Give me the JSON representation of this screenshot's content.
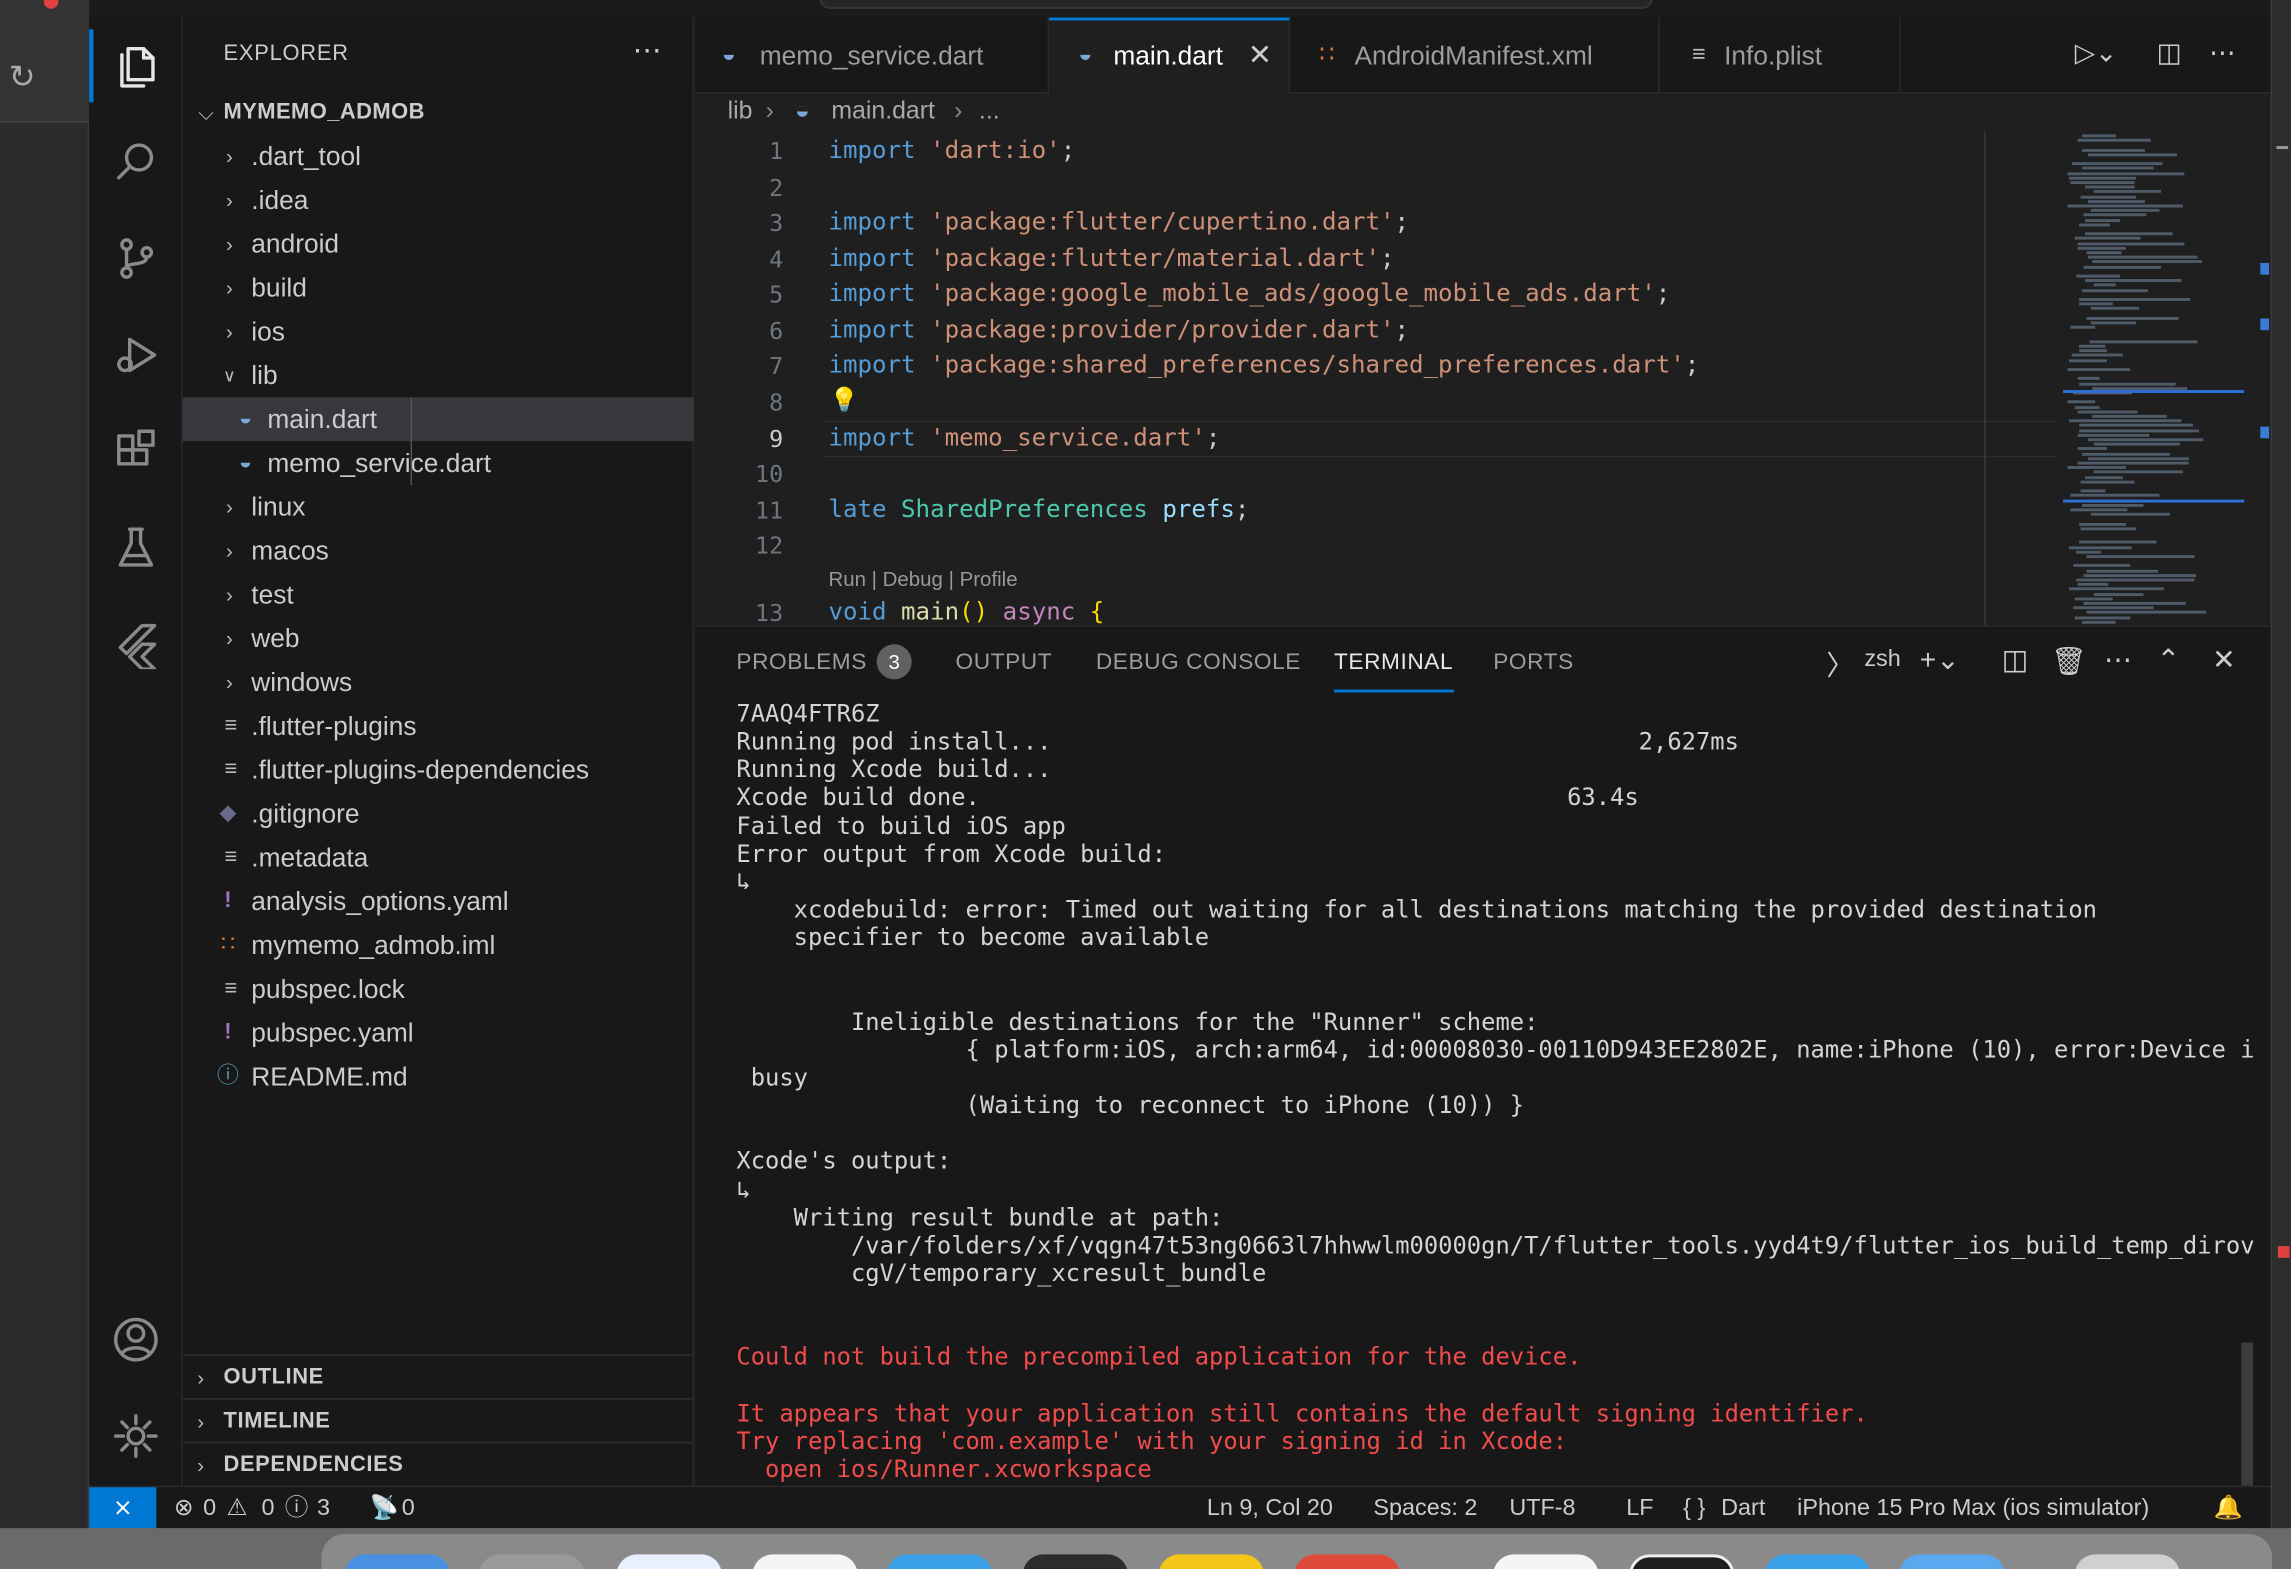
{
  "sidebar": {
    "title": "EXPLORER",
    "project": "MYMEMO_ADMOB",
    "items": [
      {
        "label": ".dart_tool",
        "type": "folder"
      },
      {
        "label": ".idea",
        "type": "folder"
      },
      {
        "label": "android",
        "type": "folder"
      },
      {
        "label": "build",
        "type": "folder"
      },
      {
        "label": "ios",
        "type": "folder"
      },
      {
        "label": "lib",
        "type": "folder-open"
      },
      {
        "label": "main.dart",
        "type": "dart"
      },
      {
        "label": "memo_service.dart",
        "type": "dart"
      },
      {
        "label": "linux",
        "type": "folder"
      },
      {
        "label": "macos",
        "type": "folder"
      },
      {
        "label": "test",
        "type": "folder"
      },
      {
        "label": "web",
        "type": "folder"
      },
      {
        "label": "windows",
        "type": "folder"
      },
      {
        "label": ".flutter-plugins",
        "type": "file"
      },
      {
        "label": ".flutter-plugins-dependencies",
        "type": "file"
      },
      {
        "label": ".gitignore",
        "type": "git"
      },
      {
        "label": ".metadata",
        "type": "file"
      },
      {
        "label": "analysis_options.yaml",
        "type": "yaml"
      },
      {
        "label": "mymemo_admob.iml",
        "type": "rss"
      },
      {
        "label": "pubspec.lock",
        "type": "file"
      },
      {
        "label": "pubspec.yaml",
        "type": "yaml"
      },
      {
        "label": "README.md",
        "type": "info"
      }
    ],
    "sections": [
      "OUTLINE",
      "TIMELINE",
      "DEPENDENCIES"
    ]
  },
  "tabs": [
    {
      "label": "memo_service.dart"
    },
    {
      "label": "main.dart"
    },
    {
      "label": "AndroidManifest.xml"
    },
    {
      "label": "Info.plist"
    }
  ],
  "breadcrumb": {
    "folder": "lib",
    "file": "main.dart",
    "more": "..."
  },
  "editor": {
    "line_numbers": [
      "1",
      "2",
      "3",
      "4",
      "5",
      "6",
      "7",
      "8",
      "9",
      "10",
      "11",
      "12",
      "13"
    ],
    "codelens": "Run | Debug | Profile",
    "lines": {
      "l1": [
        "import",
        " ",
        "'dart:io'",
        ";"
      ],
      "l3": [
        "import",
        " ",
        "'package:flutter/cupertino.dart'",
        ";"
      ],
      "l4": [
        "import",
        " ",
        "'package:flutter/material.dart'",
        ";"
      ],
      "l5": [
        "import",
        " ",
        "'package:google_mobile_ads/google_mobile_ads.dart'",
        ";"
      ],
      "l6": [
        "import",
        " ",
        "'package:provider/provider.dart'",
        ";"
      ],
      "l7": [
        "import",
        " ",
        "'package:shared_preferences/shared_preferences.dart'",
        ";"
      ],
      "l9": [
        "import",
        " ",
        "'memo_service.dart'",
        ";"
      ],
      "l11": [
        "late",
        " ",
        "SharedPreferences",
        " ",
        "prefs",
        ";"
      ],
      "l13": [
        "void",
        " ",
        "main",
        "()",
        " ",
        "async",
        " ",
        "{"
      ]
    }
  },
  "panel": {
    "tabs": [
      "PROBLEMS",
      "OUTPUT",
      "DEBUG CONSOLE",
      "TERMINAL",
      "PORTS"
    ],
    "problems_count": "3",
    "shell": "zsh",
    "terminal_lines": [
      "7AAQ4FTR6Z",
      "Running pod install...                                         2,627ms",
      "Running Xcode build...",
      "Xcode build done.                                         63.4s",
      "Failed to build iOS app",
      "Error output from Xcode build:",
      "↳",
      "    xcodebuild: error: Timed out waiting for all destinations matching the provided destination",
      "    specifier to become available",
      "",
      "",
      "        Ineligible destinations for the \"Runner\" scheme:",
      "                { platform:iOS, arch:arm64, id:00008030-00110D943EE2802E, name:iPhone (10), error:Device is",
      " busy",
      "                (Waiting to reconnect to iPhone (10)) }",
      "",
      "Xcode's output:",
      "↳",
      "    Writing result bundle at path:",
      "        /var/folders/xf/vqgn47t53ng0663l7hhwwlm00000gn/T/flutter_tools.yyd4t9/flutter_ios_build_temp_dirovL",
      "        cgV/temporary_xcresult_bundle",
      "",
      "",
      "Could not build the precompiled application for the device.",
      "",
      "It appears that your application still contains the default signing identifier.",
      "Try replacing 'com.example' with your signing id in Xcode:",
      "  open ios/Runner.xcworkspace"
    ],
    "error_line_indices": [
      23,
      25,
      26,
      27
    ]
  },
  "statusbar": {
    "errors": "0",
    "warnings": "0",
    "infos": "3",
    "ports": "0",
    "position": "Ln 9, Col 20",
    "spaces": "Spaces: 2",
    "encoding": "UTF-8",
    "eol": "LF",
    "language": "Dart",
    "device": "iPhone 15 Pro Max (ios simulator)"
  },
  "colors": {
    "accent": "#0078d4",
    "error_text": "#f14c4c",
    "keyword": "#569cd6",
    "string": "#ce9178",
    "type": "#4ec9b0"
  }
}
